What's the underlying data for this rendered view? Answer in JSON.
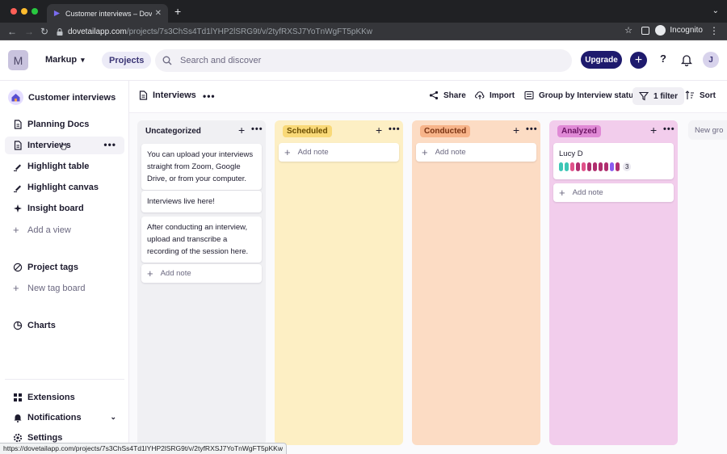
{
  "browser": {
    "tab_title": "Customer interviews – Dovetail",
    "url_host": "dovetailapp.com",
    "url_path": "/projects/7s3ChSs4Td1lYHP2lSRG9t/v/2tyfRXSJ7YoTnWgFT5pKKw",
    "profile_label": "Incognito",
    "status_url": "https://dovetailapp.com/projects/7s3ChSs4Td1lYHP2lSRG9t/v/2tyfRXSJ7YoTnWgFT5pKKw"
  },
  "header": {
    "workspace_initial": "M",
    "workspace_name": "Markup",
    "projects_label": "Projects",
    "search_placeholder": "Search and discover",
    "upgrade_label": "Upgrade",
    "plus_label": "+",
    "help_label": "?",
    "user_initial": "J"
  },
  "sidebar": {
    "project_title": "Customer interviews",
    "items": [
      {
        "label": "Planning Docs",
        "icon": "document-icon"
      },
      {
        "label": "Interviews",
        "icon": "document-icon"
      },
      {
        "label": "Highlight table",
        "icon": "highlighter-icon"
      },
      {
        "label": "Highlight canvas",
        "icon": "highlighter-icon"
      },
      {
        "label": "Insight board",
        "icon": "sparkle-icon"
      },
      {
        "label": "Add a view",
        "icon": "plus-icon"
      }
    ],
    "tag_items": [
      {
        "label": "Project tags",
        "icon": "tag-icon"
      },
      {
        "label": "New tag board",
        "icon": "plus-icon"
      }
    ],
    "charts_label": "Charts",
    "bottom_items": [
      {
        "label": "Extensions",
        "icon": "extensions-icon"
      },
      {
        "label": "Notifications",
        "icon": "bell-icon"
      },
      {
        "label": "Settings",
        "icon": "gear-icon"
      }
    ]
  },
  "toolbar": {
    "view_title": "Interviews",
    "share_label": "Share",
    "import_label": "Import",
    "group_label": "Group by Interview status",
    "filter_label": "1 filter",
    "sort_label": "Sort"
  },
  "board": {
    "add_note_label": "Add note",
    "next_column_label": "New gro",
    "columns": [
      {
        "title": "Uncategorized",
        "bg": "#f0f0f3",
        "pill_bg": "transparent",
        "pill_fg": "#1d1b2e",
        "cards": [
          "You can upload your interviews straight from Zoom, Google Drive, or from your computer.",
          "Interviews live here!",
          "After conducting an interview, upload and transcribe a recording of the session here."
        ]
      },
      {
        "title": "Scheduled",
        "bg": "#fdefc4",
        "pill_bg": "#f9d978",
        "pill_fg": "#6b4d00",
        "cards": []
      },
      {
        "title": "Conducted",
        "bg": "#fcdcc4",
        "pill_bg": "#f7b48a",
        "pill_fg": "#7a3312",
        "cards": []
      },
      {
        "title": "Analyzed",
        "bg": "#f2cdec",
        "pill_bg": "#e08ad6",
        "pill_fg": "#6a1462",
        "cards": [
          "Lucy D"
        ],
        "tag_colors": [
          "#3cc6b6",
          "#3cc6b6",
          "#e0528a",
          "#b02d6e",
          "#e0528a",
          "#b02d6e",
          "#b02d6e",
          "#b02d6e",
          "#b02d6e",
          "#8a5cf0",
          "#b02d6e"
        ],
        "tag_count": "3"
      }
    ]
  }
}
